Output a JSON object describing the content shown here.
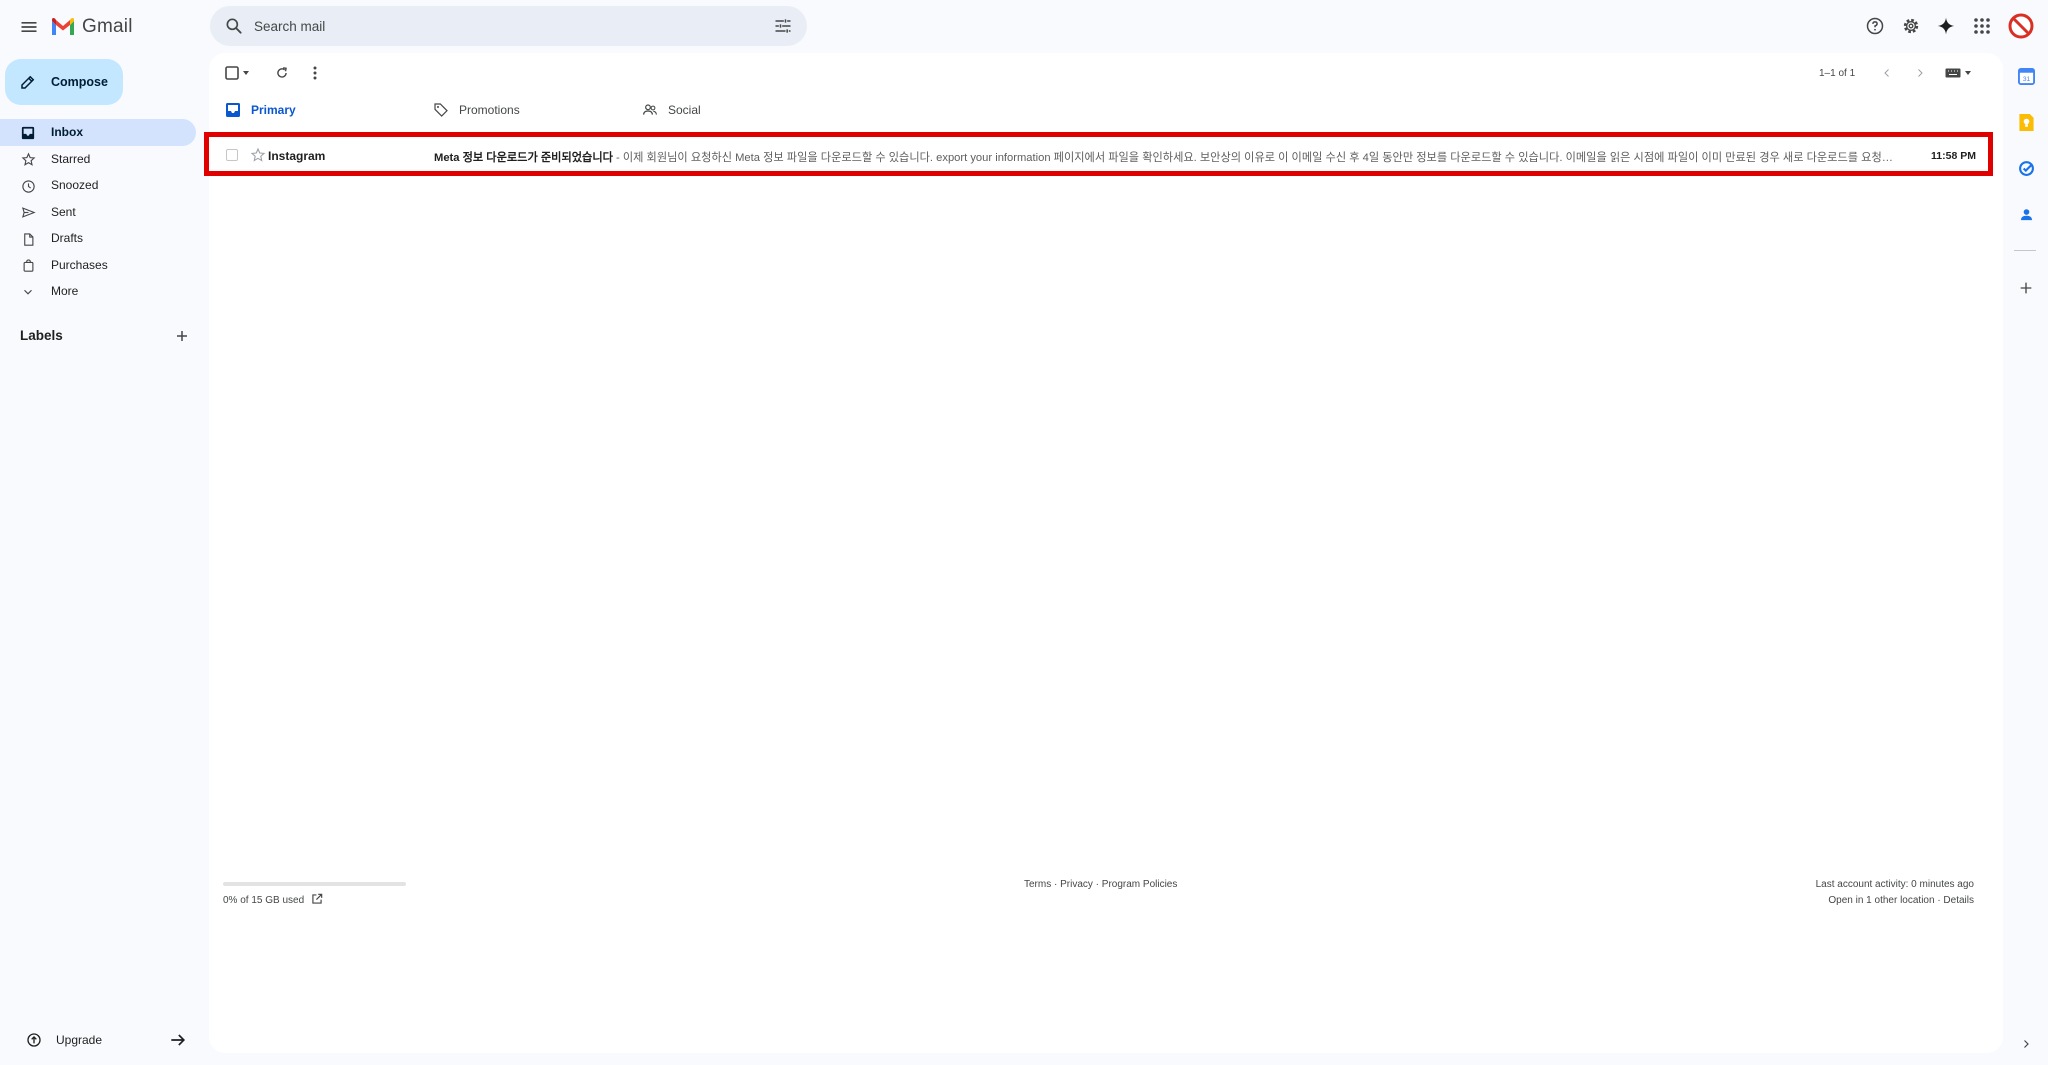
{
  "app": {
    "name": "Gmail"
  },
  "search": {
    "placeholder": "Search mail"
  },
  "compose": {
    "label": "Compose"
  },
  "nav": [
    {
      "label": "Inbox",
      "icon": "inbox-icon",
      "active": true
    },
    {
      "label": "Starred",
      "icon": "star-icon"
    },
    {
      "label": "Snoozed",
      "icon": "clock-icon"
    },
    {
      "label": "Sent",
      "icon": "send-icon"
    },
    {
      "label": "Drafts",
      "icon": "draft-icon"
    },
    {
      "label": "Purchases",
      "icon": "shopping-bag-icon"
    },
    {
      "label": "More",
      "icon": "chevron-down-icon"
    }
  ],
  "labels": {
    "title": "Labels"
  },
  "upgrade": {
    "label": "Upgrade"
  },
  "toolbar": {
    "pager": "1–1 of 1"
  },
  "tabs": [
    {
      "label": "Primary",
      "icon": "inbox-icon",
      "active": true
    },
    {
      "label": "Promotions",
      "icon": "tag-icon"
    },
    {
      "label": "Social",
      "icon": "people-icon"
    }
  ],
  "emails": [
    {
      "sender": "Instagram",
      "subject": "Meta 정보 다운로드가 준비되었습니다",
      "snippet": " - 이제 회원님이 요청하신 Meta 정보 파일을 다운로드할 수 있습니다. export your information 페이지에서 파일을 확인하세요. 보안상의 이유로 이 이메일 수신 후 4일 동안만 정보를 다운로드할 수 있습니다. 이메일을 읽은 시점에 파일이 이미 만료된 경우 새로 다운로드를 요청할 수...",
      "time": "11:58 PM"
    }
  ],
  "footer": {
    "storage": "0% of 15 GB used",
    "storage_fraction": 0.0,
    "policies": "Terms · Privacy · Program Policies",
    "activity": "Last account activity: 0 minutes ago",
    "details": "Open in 1 other location · Details"
  },
  "colors": {
    "accent": "#0b57d0",
    "compose_bg": "#c2e7ff",
    "active_nav_bg": "#d3e3fd",
    "highlight_border": "#e00000",
    "page_bg": "#f8fafd"
  }
}
